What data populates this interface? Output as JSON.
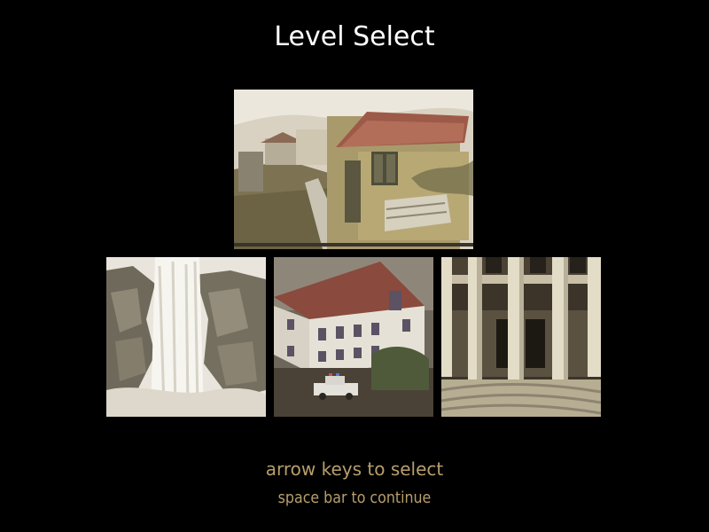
{
  "screen": {
    "title": "Level Select",
    "hint_select": "arrow keys to select",
    "hint_continue": "space bar to continue"
  },
  "levels": [
    {
      "id": "village",
      "scene": "hillside village house with tiled roof and stone path",
      "selected": true
    },
    {
      "id": "waterfall",
      "scene": "waterfall over rocky cliff"
    },
    {
      "id": "mansion",
      "scene": "large white mansion with red roof and parked truck"
    },
    {
      "id": "palace",
      "scene": "columned palace entrance with dark doors"
    }
  ],
  "colors": {
    "background": "#000000",
    "title": "#ffffff",
    "hint": "#b79f6c"
  }
}
